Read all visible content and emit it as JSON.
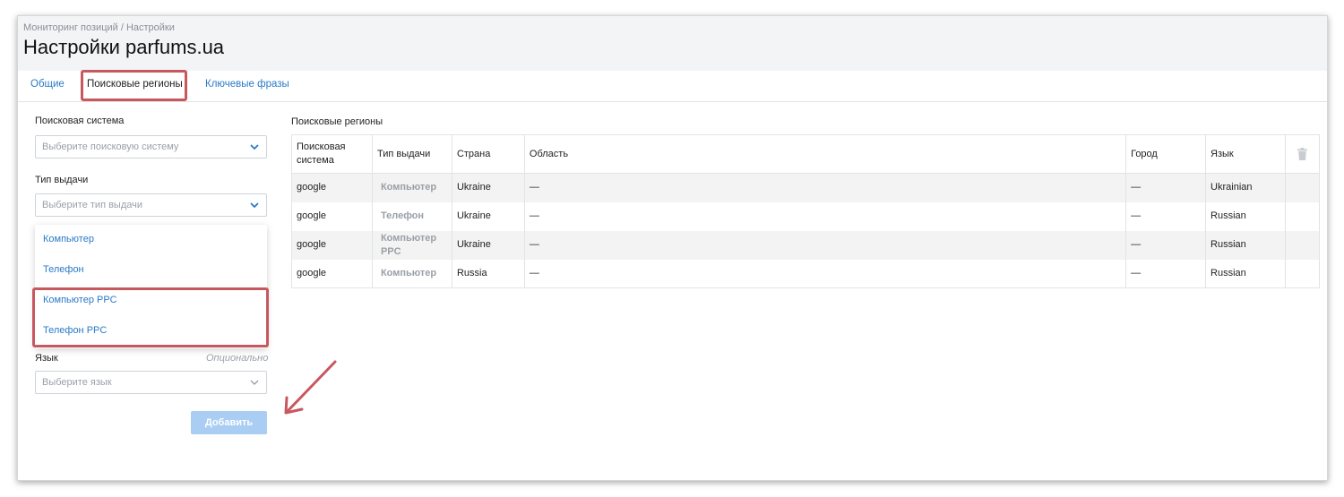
{
  "breadcrumb": "Мониторинг позиций / Настройки",
  "page_title": "Настройки parfums.ua",
  "tabs": [
    {
      "label": "Общие"
    },
    {
      "label": "Поисковые регионы"
    },
    {
      "label": "Ключевые фразы"
    }
  ],
  "form": {
    "engine_label": "Поисковая система",
    "engine_placeholder": "Выберите поисковую систему",
    "type_label": "Тип выдачи",
    "type_placeholder": "Выберите тип выдачи",
    "type_options": [
      "Компьютер",
      "Телефон",
      "Компьютер PPC",
      "Телефон PPC"
    ],
    "language_label": "Язык",
    "language_optional": "Опционально",
    "language_placeholder": "Выберите язык",
    "add_button": "Добавить"
  },
  "regions": {
    "title": "Поисковые регионы",
    "columns": [
      "Поисковая система",
      "Тип выдачи",
      "Страна",
      "Область",
      "Город",
      "Язык"
    ],
    "rows": [
      {
        "engine": "google",
        "type": "Компьютер",
        "country": "Ukraine",
        "region": "—",
        "city": "—",
        "language": "Ukrainian"
      },
      {
        "engine": "google",
        "type": "Телефон",
        "country": "Ukraine",
        "region": "—",
        "city": "—",
        "language": "Russian"
      },
      {
        "engine": "google",
        "type": "Компьютер PPC",
        "country": "Ukraine",
        "region": "—",
        "city": "—",
        "language": "Russian"
      },
      {
        "engine": "google",
        "type": "Компьютер",
        "country": "Russia",
        "region": "—",
        "city": "—",
        "language": "Russian"
      }
    ]
  },
  "colors": {
    "link": "#2a7ac7",
    "highlight": "#c7585e",
    "button": "#a9cdf3"
  }
}
